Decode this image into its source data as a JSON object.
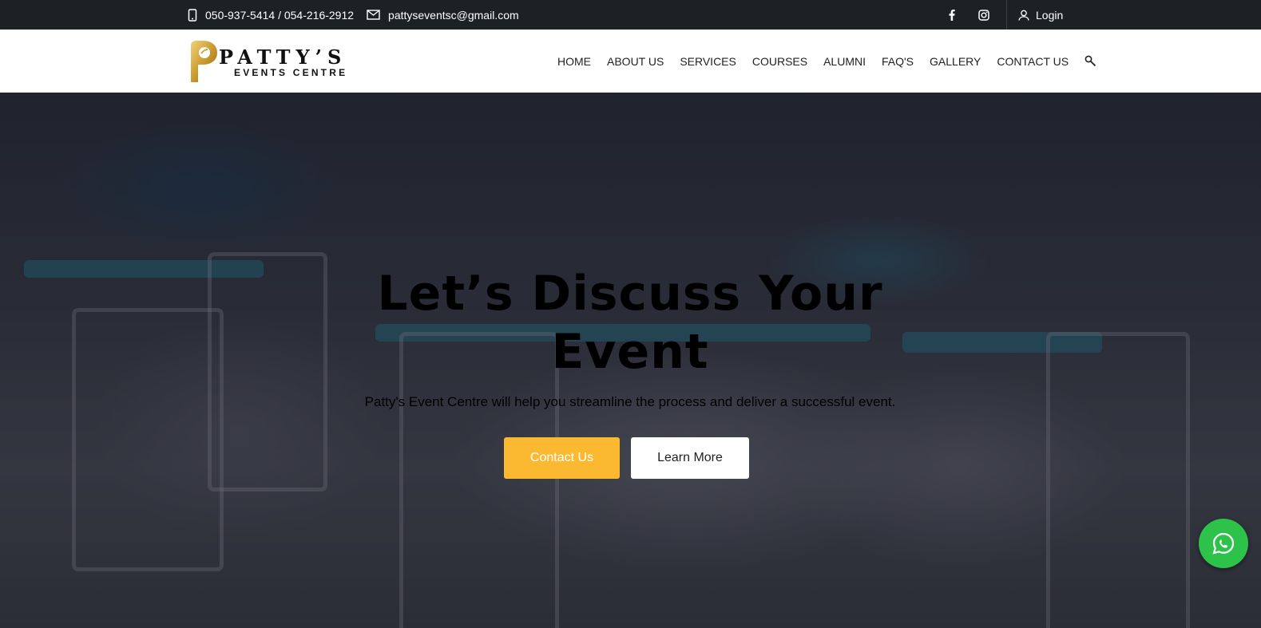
{
  "topbar": {
    "phone": "050-937-5414 / 054-216-2912",
    "email": "pattyseventsc@gmail.com",
    "login": "Login",
    "icons": [
      "phone-icon",
      "mail-icon",
      "facebook-icon",
      "instagram-icon",
      "user-icon"
    ]
  },
  "header": {
    "logo_brand": "PATTY’S",
    "logo_sub": "EVENTS CENTRE",
    "nav": [
      "HOME",
      "ABOUT US",
      "SERVICES",
      "COURSES",
      "ALUMNI",
      "FAQ'S",
      "GALLERY",
      "CONTACT US"
    ]
  },
  "hero": {
    "title_line1": "Let’s Discuss Your",
    "title_line2": "Event",
    "subtitle": "Patty's Event Centre will help you streamline the process and deliver a successful event.",
    "primary_button": "Contact Us",
    "secondary_button": "Learn More"
  },
  "colors": {
    "topbar_bg": "#1c2126",
    "accent": "#fbb931",
    "whatsapp": "#2dc24a"
  }
}
